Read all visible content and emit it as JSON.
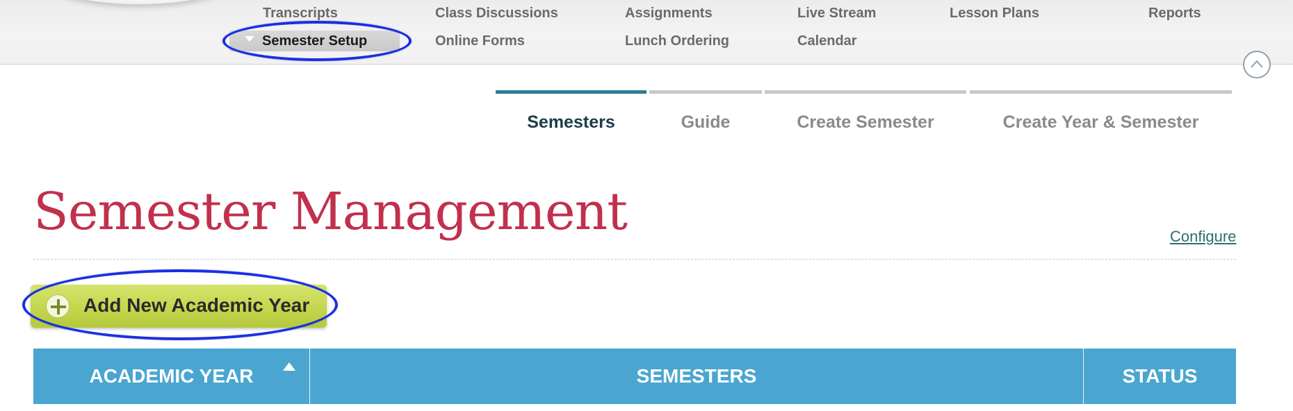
{
  "topnav": {
    "row1": [
      "Transcripts",
      "Class Discussions",
      "Assignments",
      "Live Stream",
      "Lesson Plans",
      "Reports"
    ],
    "row2_active": "Semester Setup",
    "row2": [
      "Online Forms",
      "Lunch Ordering",
      "Calendar"
    ]
  },
  "tabs": [
    {
      "label": "Semesters",
      "active": true
    },
    {
      "label": "Guide",
      "active": false
    },
    {
      "label": "Create Semester",
      "active": false
    },
    {
      "label": "Create Year & Semester",
      "active": false
    }
  ],
  "page": {
    "title": "Semester Management",
    "configure_label": "Configure"
  },
  "add_button": {
    "label": "Add New Academic Year"
  },
  "table": {
    "columns": [
      "ACADEMIC YEAR",
      "SEMESTERS",
      "STATUS"
    ],
    "sorted_column": "ACADEMIC YEAR",
    "sort_direction": "ascending"
  },
  "colors": {
    "highlight": "#1a2fe0",
    "title": "#c1304c",
    "active_tab": "#2c7d93",
    "table_header": "#4aa6d0",
    "add_button": "#c3d54a"
  }
}
